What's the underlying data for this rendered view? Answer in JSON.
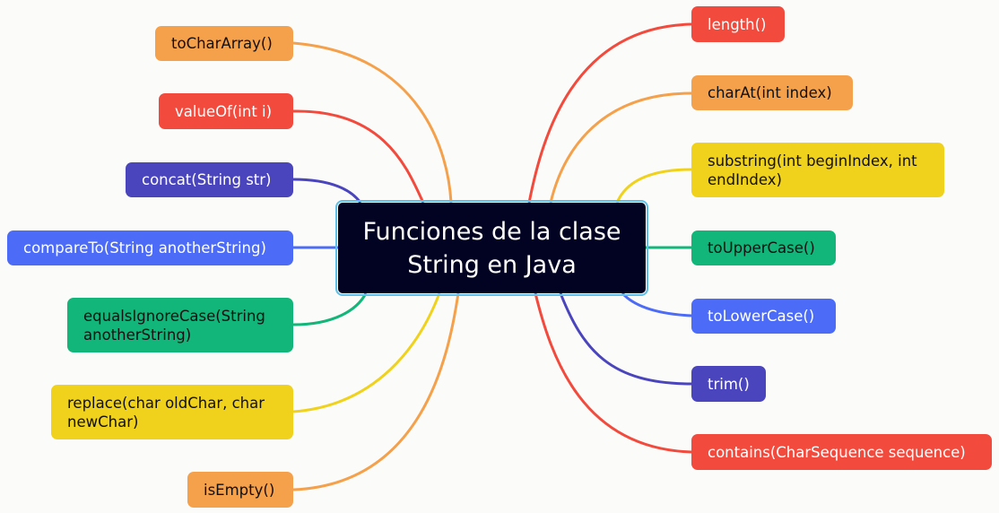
{
  "title": "Funciones de la clase String en Java",
  "colors": {
    "orange": "#f5a04b",
    "red": "#f24a3d",
    "indigo": "#4a45bd",
    "blue": "#4c6bf6",
    "green": "#12b57a",
    "yellow": "#f0d21c",
    "center": "#020322",
    "center_border": "#5cc0ea"
  },
  "left_nodes": [
    {
      "label": "toCharArray()",
      "color": "orange"
    },
    {
      "label": "valueOf(int i)",
      "color": "red"
    },
    {
      "label": "concat(String str)",
      "color": "indigo"
    },
    {
      "label": "compareTo(String anotherString)",
      "color": "blue"
    },
    {
      "label": "equalsIgnoreCase(String anotherString)",
      "color": "green"
    },
    {
      "label": "replace(char oldChar, char newChar)",
      "color": "yellow"
    },
    {
      "label": "isEmpty()",
      "color": "orange"
    }
  ],
  "right_nodes": [
    {
      "label": "length()",
      "color": "red"
    },
    {
      "label": "charAt(int index)",
      "color": "orange"
    },
    {
      "label": "substring(int beginIndex, int endIndex)",
      "color": "yellow"
    },
    {
      "label": "toUpperCase()",
      "color": "green"
    },
    {
      "label": "toLowerCase()",
      "color": "blue"
    },
    {
      "label": "trim()",
      "color": "indigo"
    },
    {
      "label": "contains(CharSequence sequence)",
      "color": "red"
    }
  ]
}
